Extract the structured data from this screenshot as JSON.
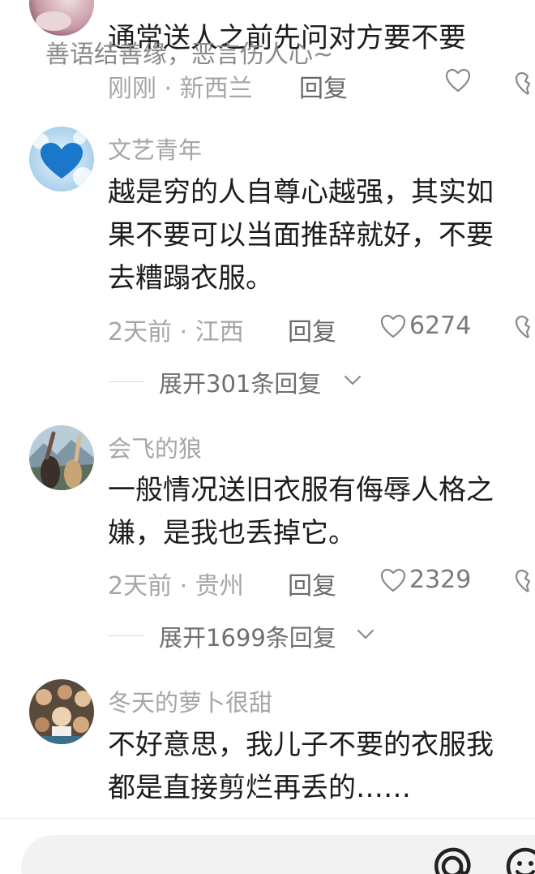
{
  "comments": [
    {
      "username": "",
      "lines": [
        "通常送人之前先问对方要不要"
      ],
      "time_location": "刚刚 · 新西兰",
      "reply_label": "回复",
      "like_count": "",
      "expand_label": ""
    },
    {
      "username": "文艺青年",
      "lines": [
        "越是穷的人自尊心越强，其实如",
        "果不要可以当面推辞就好，不要",
        "去糟蹋衣服。"
      ],
      "time_location": "2天前 · 江西",
      "reply_label": "回复",
      "like_count": "6274",
      "expand_label": "展开301条回复"
    },
    {
      "username": "会飞的狼",
      "lines": [
        "一般情况送旧衣服有侮辱人格之",
        "嫌，是我也丢掉它。"
      ],
      "time_location": "2天前 · 贵州",
      "reply_label": "回复",
      "like_count": "2329",
      "expand_label": "展开1699条回复"
    },
    {
      "username": "冬天的萝卜很甜",
      "lines": [
        "不好意思，我儿子不要的衣服我",
        "都是直接剪烂再丢的……"
      ],
      "time_location": "",
      "reply_label": "",
      "like_count": "",
      "expand_label": ""
    }
  ],
  "input": {
    "placeholder": "善语结善缘，恶言伤人心~"
  },
  "icons": {
    "like": "heart-outline-icon",
    "dislike": "broken-heart-icon",
    "expand": "chevron-down-icon",
    "mention": "at-icon",
    "emoji": "emoji-icon"
  },
  "colors": {
    "username": "#a6a6a6",
    "body_text": "#1c1c1c",
    "meta": "#a6a6a6"
  }
}
